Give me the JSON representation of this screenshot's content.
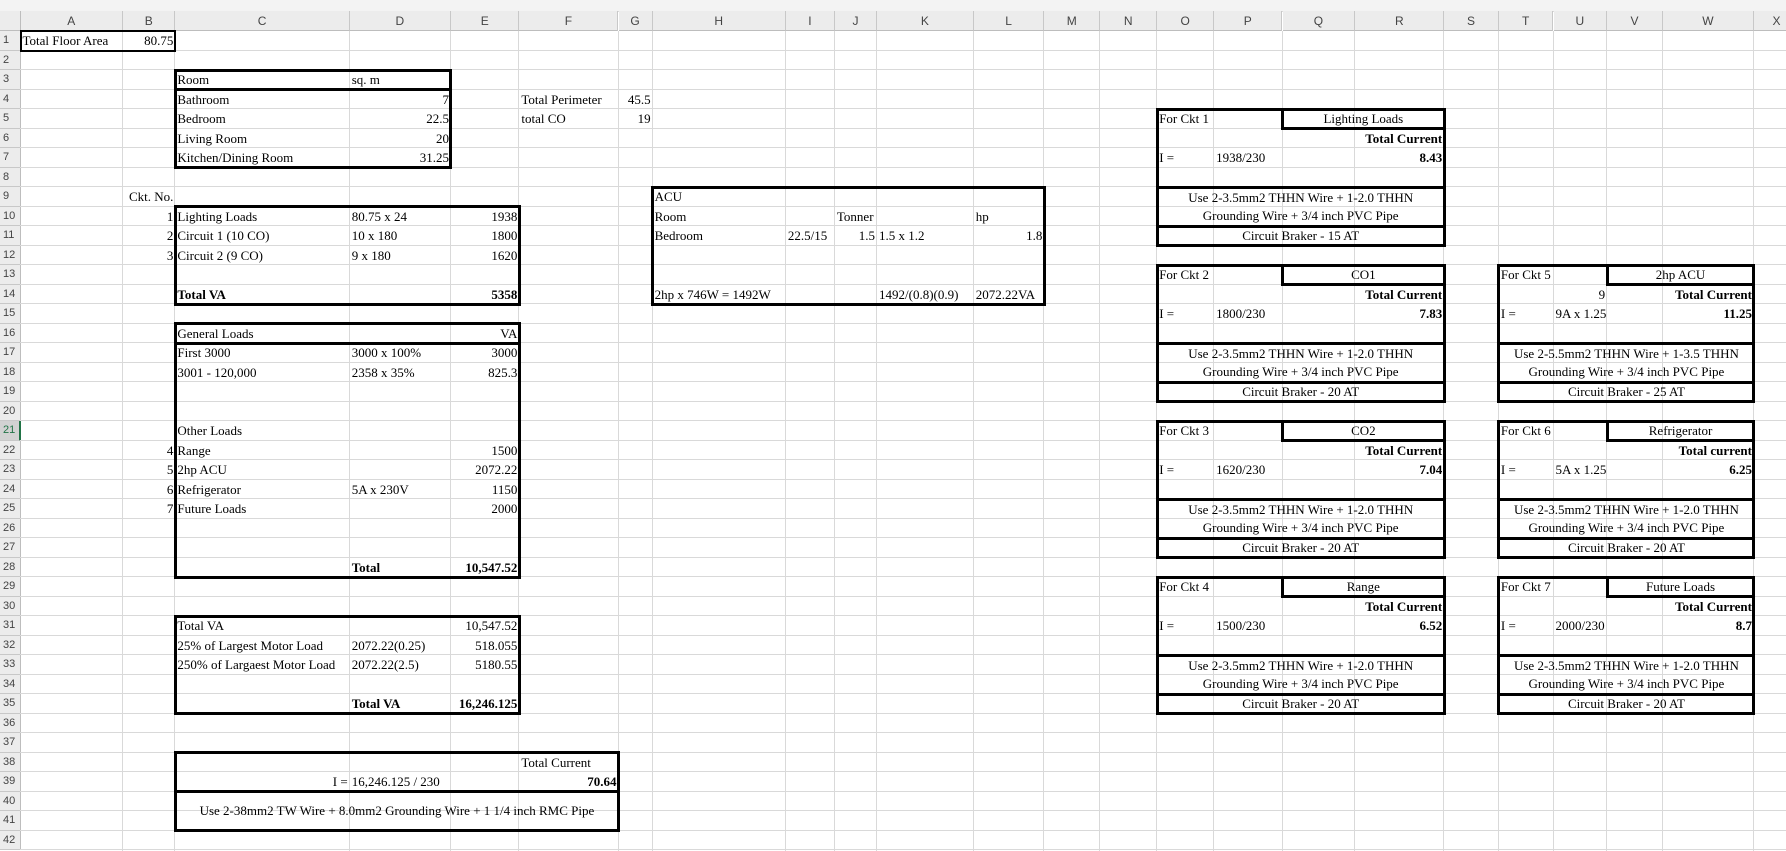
{
  "columns": [
    "A",
    "B",
    "C",
    "D",
    "E",
    "F",
    "G",
    "H",
    "I",
    "J",
    "K",
    "L",
    "M",
    "N",
    "O",
    "P",
    "Q",
    "R",
    "S",
    "T",
    "U",
    "V",
    "W",
    "X"
  ],
  "rows": [
    "1",
    "2",
    "3",
    "4",
    "5",
    "6",
    "7",
    "8",
    "9",
    "10",
    "11",
    "12",
    "13",
    "14",
    "15",
    "16",
    "17",
    "18",
    "19",
    "20",
    "21",
    "22",
    "23",
    "24",
    "25",
    "26",
    "27",
    "28",
    "29",
    "30",
    "31",
    "32",
    "33",
    "34",
    "35",
    "36",
    "37",
    "38",
    "39",
    "40",
    "41",
    "42"
  ],
  "selected_row": "21",
  "floor_area": {
    "label": "Total Floor Area",
    "value": "80.75"
  },
  "rooms": {
    "header": {
      "room": "Room",
      "area": "sq. m"
    },
    "items": [
      {
        "room": "Bathroom",
        "area": "7"
      },
      {
        "room": "Bedroom",
        "area": "22.5"
      },
      {
        "room": "Living Room",
        "area": "20"
      },
      {
        "room": "Kitchen/Dining Room",
        "area": "31.25"
      }
    ]
  },
  "perimeter": {
    "label": "Total Perimeter",
    "value": "45.5",
    "co_label": "total CO",
    "co_value": "19"
  },
  "circuits": {
    "header": "Ckt. No.",
    "items": [
      {
        "no": "1",
        "name": "Lighting Loads",
        "calc": "80.75 x 24",
        "va": "1938"
      },
      {
        "no": "2",
        "name": "Circuit 1 (10 CO)",
        "calc": "10 x 180",
        "va": "1800"
      },
      {
        "no": "3",
        "name": "Circuit 2 (9 CO)",
        "calc": "9 x 180",
        "va": "1620"
      }
    ],
    "total_label": "Total VA",
    "total": "5358"
  },
  "general_loads": {
    "header": "General Loads",
    "va_header": "VA",
    "items": [
      {
        "name": "First 3000",
        "calc": "3000 x 100%",
        "va": "3000"
      },
      {
        "name": "3001 - 120,000",
        "calc": "2358 x 35%",
        "va": "825.3"
      }
    ],
    "other_header": "Other Loads",
    "other_items": [
      {
        "no": "4",
        "name": "Range",
        "calc": "",
        "va": "1500"
      },
      {
        "no": "5",
        "name": "2hp ACU",
        "calc": "",
        "va": "2072.22"
      },
      {
        "no": "6",
        "name": "Refrigerator",
        "calc": "5A x 230V",
        "va": "1150"
      },
      {
        "no": "7",
        "name": "Future Loads",
        "calc": "",
        "va": "2000"
      }
    ],
    "total_label": "Total",
    "total": "10,547.52"
  },
  "motor_calc": {
    "items": [
      {
        "name": "Total VA",
        "calc": "",
        "va": "10,547.52"
      },
      {
        "name": "25% of Largest Motor Load",
        "calc": "2072.22(0.25)",
        "va": "518.055"
      },
      {
        "name": "250% of Largaest Motor Load",
        "calc": "2072.22(2.5)",
        "va": "5180.55"
      }
    ],
    "total_label": "Total VA",
    "total": "16,246.125"
  },
  "main_feeder": {
    "total_current_label": "Total Current",
    "i_label": "I =",
    "formula": "16,246.125 / 230",
    "current": "70.64",
    "wire": "Use 2-38mm2 TW Wire + 8.0mm2 Grounding Wire + 1 1/4 inch RMC Pipe"
  },
  "acu": {
    "title": "ACU",
    "room_label": "Room",
    "tonner_label": "Tonner",
    "hp_label": "hp",
    "room": "Bedroom",
    "ratio": "22.5/15",
    "tonner": "1.5",
    "hp_calc": "1.5 x 1.2",
    "hp": "1.8",
    "watts_calc": "2hp x 746W = 1492W",
    "va_calc": "1492/(0.8)(0.9)",
    "va": "2072.22VA"
  },
  "ckt_boxes": [
    {
      "title": "For Ckt 1",
      "label": "Lighting Loads",
      "extra": "",
      "total_label": "Total Current",
      "i_label": "I =",
      "formula": "1938/230",
      "current": "8.43",
      "wire": "Use 2-3.5mm2 THHN Wire + 1-2.0 THHN Grounding Wire + 3/4 inch PVC Pipe",
      "breaker": "Circuit Braker - 15 AT"
    },
    {
      "title": "For Ckt 2",
      "label": "CO1",
      "extra": "",
      "total_label": "Total Current",
      "i_label": "I =",
      "formula": "1800/230",
      "current": "7.83",
      "wire": "Use 2-3.5mm2 THHN Wire + 1-2.0 THHN Grounding Wire + 3/4 inch PVC Pipe",
      "breaker": "Circuit Braker - 20 AT"
    },
    {
      "title": "For Ckt 3",
      "label": "CO2",
      "extra": "",
      "total_label": "Total Current",
      "i_label": "I =",
      "formula": "1620/230",
      "current": "7.04",
      "wire": "Use 2-3.5mm2 THHN Wire + 1-2.0 THHN Grounding Wire + 3/4 inch PVC Pipe",
      "breaker": "Circuit Braker - 20 AT"
    },
    {
      "title": "For Ckt 4",
      "label": "Range",
      "extra": "",
      "total_label": "Total Current",
      "i_label": "I =",
      "formula": "1500/230",
      "current": "6.52",
      "wire": "Use 2-3.5mm2 THHN Wire + 1-2.0 THHN Grounding Wire + 3/4 inch PVC Pipe",
      "breaker": "Circuit Braker - 20 AT"
    },
    {
      "title": "For Ckt 5",
      "label": "2hp ACU",
      "extra": "9",
      "total_label": "Total Current",
      "i_label": "I =",
      "formula": "9A x 1.25",
      "current": "11.25",
      "wire": "Use 2-5.5mm2 THHN Wire + 1-3.5 THHN Grounding Wire + 3/4 inch PVC Pipe",
      "breaker": "Circuit Braker - 25 AT"
    },
    {
      "title": "For Ckt 6",
      "label": "Refrigerator",
      "extra": "",
      "total_label": "Total current",
      "i_label": "I =",
      "formula": "5A x 1.25",
      "current": "6.25",
      "wire": "Use 2-3.5mm2 THHN Wire + 1-2.0 THHN Grounding Wire + 3/4 inch PVC Pipe",
      "breaker": "Circuit Braker - 20 AT"
    },
    {
      "title": "For Ckt 7",
      "label": "Future Loads",
      "extra": "",
      "total_label": "Total Current",
      "i_label": "I =",
      "formula": "2000/230",
      "current": "8.7",
      "wire": "Use 2-3.5mm2 THHN Wire + 1-2.0 THHN Grounding Wire + 3/4 inch PVC Pipe",
      "breaker": "Circuit Braker - 20 AT"
    }
  ]
}
